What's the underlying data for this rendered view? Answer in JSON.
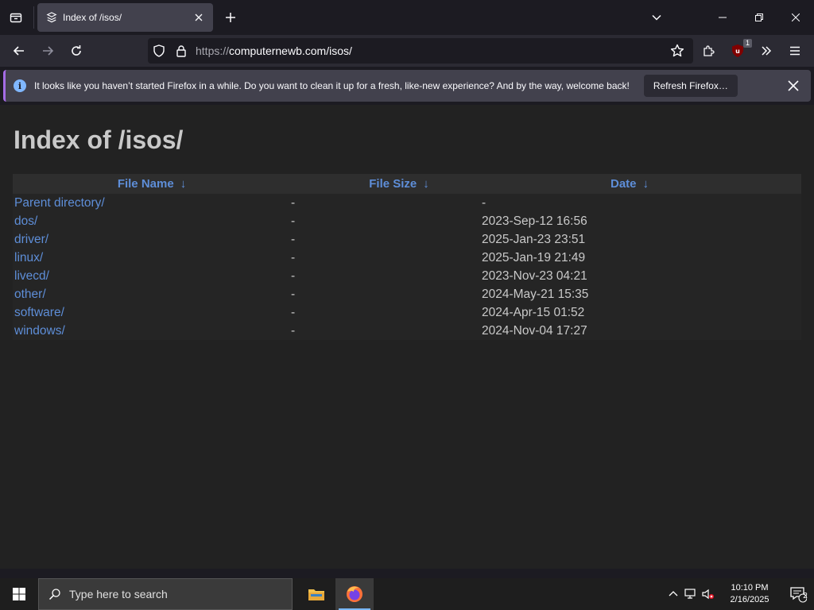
{
  "browser": {
    "tab": {
      "title": "Index of /isos/"
    },
    "url": {
      "protocol": "https://",
      "host_path": "computernewb.com/isos/"
    },
    "extension_badge": "1"
  },
  "notification": {
    "message": "It looks like you haven’t started Firefox in a while. Do you want to clean it up for a fresh, like-new experience? And by the way, welcome back!",
    "button_label": "Refresh Firefox…",
    "icon": "info-icon"
  },
  "page": {
    "heading": "Index of /isos/",
    "columns": {
      "name": "File Name",
      "size": "File Size",
      "date": "Date",
      "sort_arrow": "↓"
    },
    "rows": [
      {
        "name": "Parent directory/",
        "size": "-",
        "date": "-"
      },
      {
        "name": "dos/",
        "size": "-",
        "date": "2023-Sep-12 16:56"
      },
      {
        "name": "driver/",
        "size": "-",
        "date": "2025-Jan-23 23:51"
      },
      {
        "name": "linux/",
        "size": "-",
        "date": "2025-Jan-19 21:49"
      },
      {
        "name": "livecd/",
        "size": "-",
        "date": "2023-Nov-23 04:21"
      },
      {
        "name": "other/",
        "size": "-",
        "date": "2024-May-21 15:35"
      },
      {
        "name": "software/",
        "size": "-",
        "date": "2024-Apr-15 01:52"
      },
      {
        "name": "windows/",
        "size": "-",
        "date": "2024-Nov-04 17:27"
      }
    ]
  },
  "taskbar": {
    "search_placeholder": "Type here to search",
    "clock_time": "10:10 PM",
    "clock_date": "2/16/2025",
    "notification_count": "2"
  },
  "colors": {
    "link": "#5e8ed8",
    "page_bg": "#222222",
    "text": "#c9c9c9",
    "notification_accent": "#a56ce6"
  }
}
